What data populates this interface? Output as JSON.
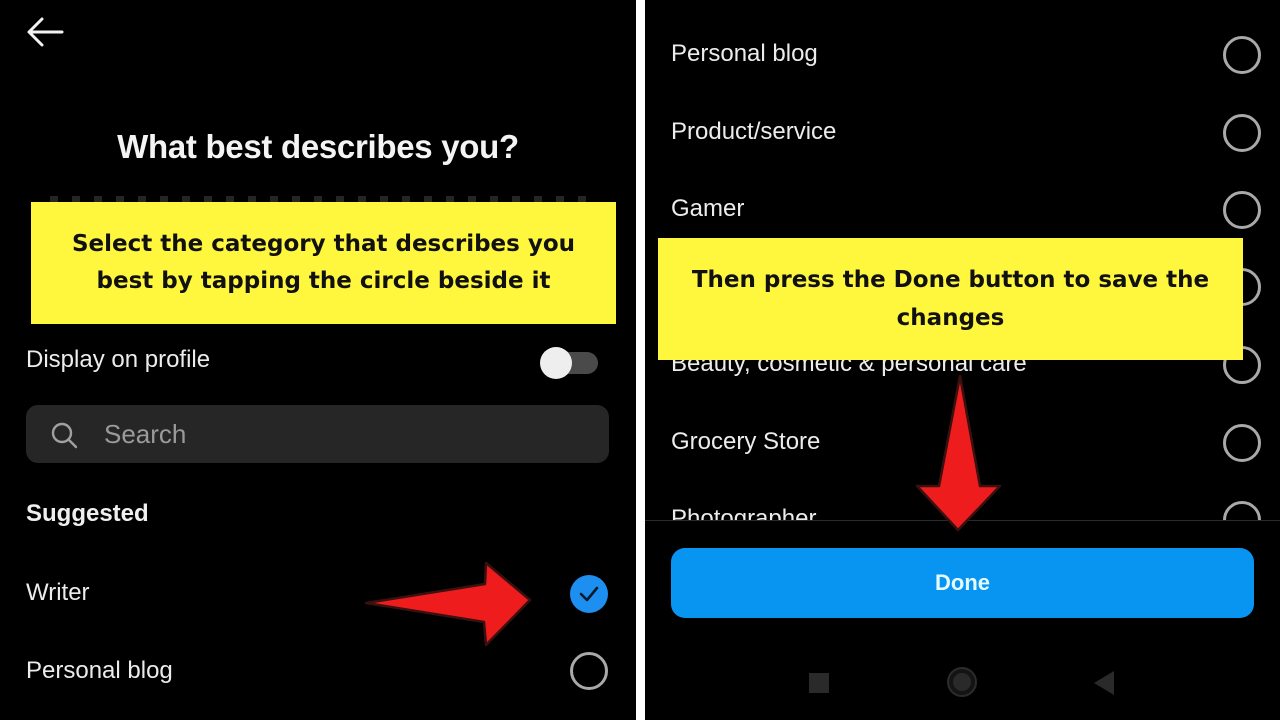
{
  "left_screen": {
    "back_icon": "arrow-left-icon",
    "title": "What best describes you?",
    "display_on_profile": {
      "label": "Display on profile",
      "enabled": false
    },
    "search": {
      "placeholder": "Search",
      "value": "",
      "icon": "search-icon"
    },
    "section_label": "Suggested",
    "options": [
      {
        "label": "Writer",
        "selected": true
      },
      {
        "label": "Personal blog",
        "selected": false
      }
    ]
  },
  "right_screen": {
    "options": [
      {
        "label": "Personal blog",
        "selected": false
      },
      {
        "label": "Product/service",
        "selected": false
      },
      {
        "label": "Gamer",
        "selected": false
      },
      {
        "label": "",
        "selected": false
      },
      {
        "label": "Beauty, cosmetic & personal care",
        "selected": false
      },
      {
        "label": "Grocery Store",
        "selected": false
      },
      {
        "label": "Photographer",
        "selected": false
      }
    ],
    "done_label": "Done",
    "nav_bar": [
      "recents-icon",
      "home-icon",
      "back-icon"
    ]
  },
  "annotations": {
    "left_callout": "Select the category that describes you best by tapping the circle beside it",
    "right_callout": "Then press the Done button to save the changes"
  },
  "colors": {
    "background": "#000000",
    "accent_blue": "#0895f2",
    "callout_yellow": "#fff73e",
    "arrow_red": "#ee1c1c"
  }
}
